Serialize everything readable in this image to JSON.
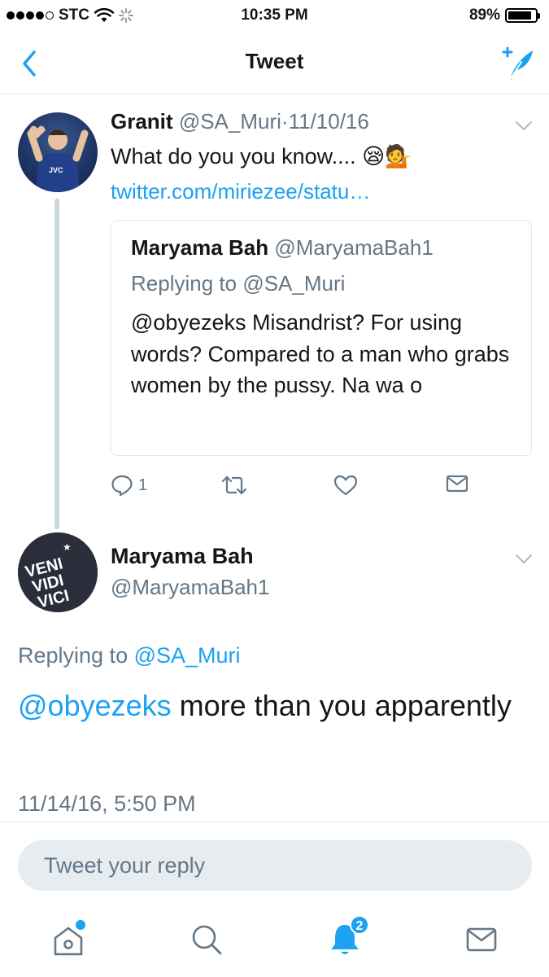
{
  "status_bar": {
    "carrier": "STC",
    "time": "10:35 PM",
    "battery": "89%",
    "battery_level": 0.89,
    "signal_bars": 4,
    "icons": [
      "wifi-icon",
      "activity-spinner-icon",
      "battery-icon"
    ]
  },
  "nav": {
    "title": "Tweet",
    "icons": [
      "back-chevron-icon",
      "compose-tweet-icon"
    ]
  },
  "parent_tweet": {
    "name": "Granit",
    "handle": "@SA_Muri",
    "separator": "·",
    "date": "11/10/16",
    "text": "What do you  you know.... 😪💁",
    "link": "twitter.com/miriezee/statu…",
    "quoted": {
      "name": "Maryama Bah",
      "handle": "@MaryamaBah1",
      "replying_prefix": "Replying to",
      "replying_to": "@SA_Muri",
      "text": "@obyezeks Misandrist?  For using words?  Compared to a man who grabs women by the pussy. Na wa o"
    },
    "actions": {
      "reply_count": "1",
      "icons": [
        "reply-icon",
        "retweet-icon",
        "like-icon",
        "direct-message-icon"
      ]
    }
  },
  "main_tweet": {
    "name": "Maryama Bah",
    "handle": "@MaryamaBah1",
    "avatar_text": [
      "VENI",
      "VIDI",
      "VICI"
    ],
    "replying_prefix": "Replying to",
    "replying_to": "@SA_Muri",
    "mention": "@obyezeks",
    "text_rest": " more than you apparently",
    "timestamp": "11/14/16, 5:50 PM"
  },
  "reply_bar": {
    "placeholder": "Tweet your reply"
  },
  "tab_bar": {
    "tabs": [
      "home-icon",
      "search-icon",
      "notifications-icon",
      "messages-icon"
    ],
    "notification_badge": "2"
  },
  "colors": {
    "accent": "#1da1f2",
    "text": "#14171a",
    "secondary": "#657786",
    "border": "#e1e8ed"
  }
}
